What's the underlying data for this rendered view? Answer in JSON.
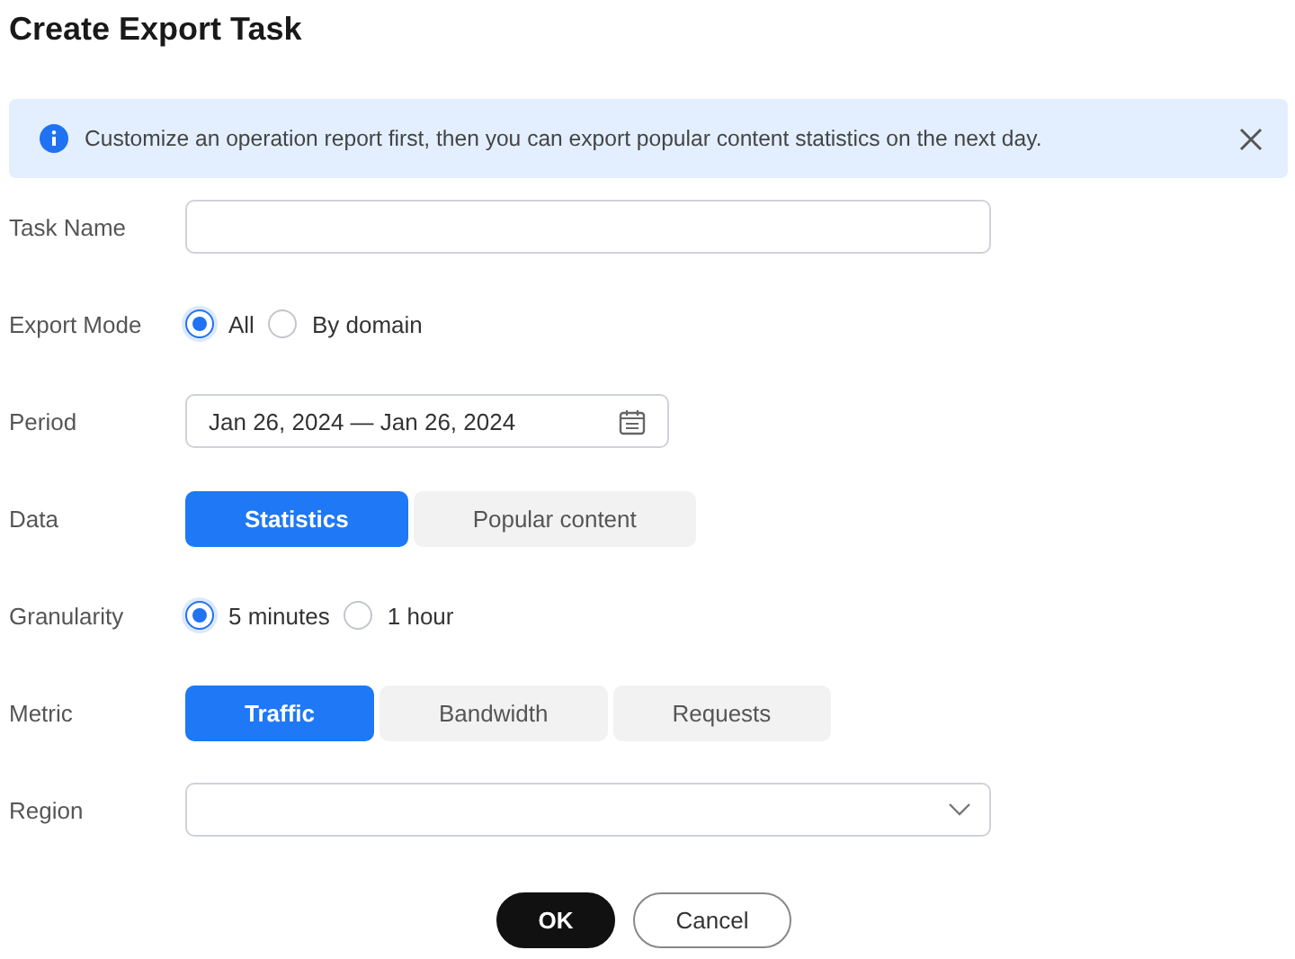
{
  "title": "Create Export Task",
  "notice": {
    "text": "Customize an operation report first, then you can export popular content statistics on the next day."
  },
  "fields": [
    {
      "kind": "input",
      "label": "Task Name"
    },
    {
      "kind": "radio",
      "label": "Export Mode",
      "options": [
        {
          "label": "All",
          "selected": true
        },
        {
          "label": "By domain",
          "selected": false
        }
      ]
    },
    {
      "kind": "date",
      "label": "Period",
      "value": "Jan 26, 2024 — Jan 26, 2024"
    },
    {
      "kind": "segmented",
      "label": "Data",
      "options": [
        {
          "label": "Statistics",
          "selected": true
        },
        {
          "label": "Popular content",
          "selected": false
        }
      ]
    },
    {
      "kind": "radio",
      "label": "Granularity",
      "options": [
        {
          "label": "5 minutes",
          "selected": true
        },
        {
          "label": "1 hour",
          "selected": false
        }
      ]
    },
    {
      "kind": "segmented",
      "label": "Metric",
      "options": [
        {
          "label": "Traffic",
          "selected": true
        },
        {
          "label": "Bandwidth",
          "selected": false
        },
        {
          "label": "Requests",
          "selected": false
        }
      ]
    },
    {
      "kind": "select",
      "label": "Region"
    }
  ],
  "buttons": [
    {
      "label": "OK",
      "kind": "primary"
    },
    {
      "label": "Cancel",
      "kind": "secondary"
    }
  ]
}
